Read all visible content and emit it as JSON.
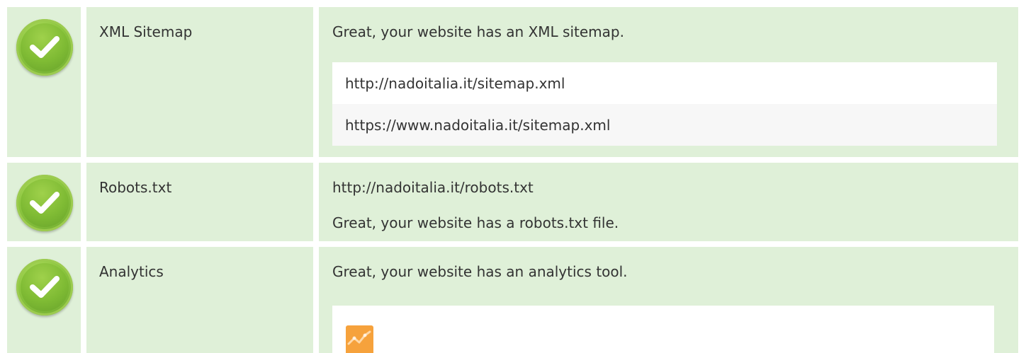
{
  "rows": [
    {
      "status": "passed",
      "label": "XML Sitemap",
      "message": "Great, your website has an XML sitemap.",
      "sitemaps": [
        "http://nadoitalia.it/sitemap.xml",
        "https://www.nadoitalia.it/sitemap.xml"
      ]
    },
    {
      "status": "passed",
      "label": "Robots.txt",
      "url": "http://nadoitalia.it/robots.txt",
      "message": "Great, your website has a robots.txt file."
    },
    {
      "status": "passed",
      "label": "Analytics",
      "message": "Great, your website has an analytics tool.",
      "tool_icon": "google-analytics-icon"
    }
  ],
  "colors": {
    "row_background": "#dff0d8",
    "check_green": "#8cc63f",
    "analytics_orange": "#f6a23c"
  }
}
